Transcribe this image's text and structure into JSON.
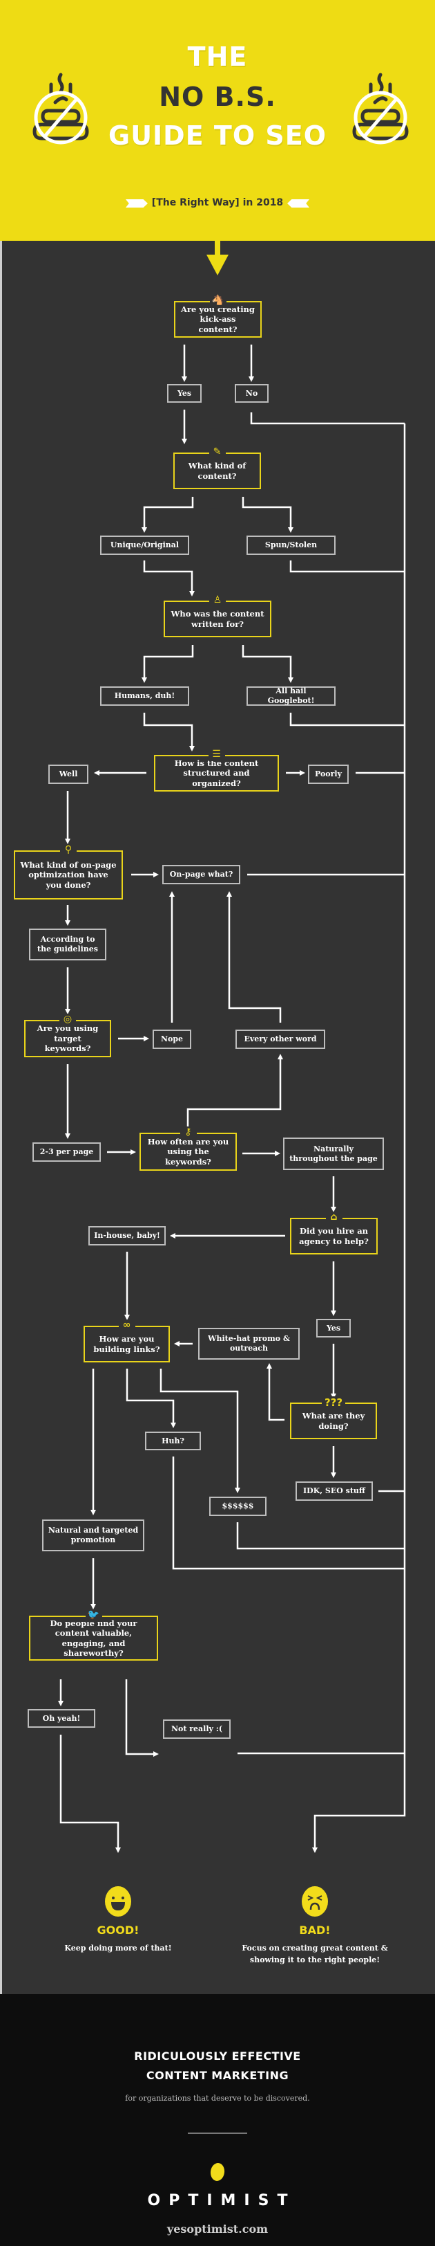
{
  "header": {
    "title_line1": "THE",
    "title_line2": "NO B.S.",
    "title_line3": "GUIDE TO SEO",
    "subtitle": "[The Right Way] in 2018",
    "icon": "no-bs-poop-icon"
  },
  "colors": {
    "brand_yellow": "#EEDC14",
    "panel_dark": "#333333",
    "footer_black": "#0d0d0d",
    "question_border": "#E9D41A",
    "answer_border": "#bdbdbd"
  },
  "flowchart": {
    "questions": [
      {
        "id": "q1",
        "text": "Are you creating kick-ass content?",
        "icon": "unicorn-icon",
        "glyph": "🐴"
      },
      {
        "id": "q2",
        "text": "What kind of content?",
        "icon": "pencil-icon",
        "glyph": "✎"
      },
      {
        "id": "q3",
        "text": "Who was the content written for?",
        "icon": "person-icon",
        "glyph": "♙"
      },
      {
        "id": "q4",
        "text": "How is the content structured and organized?",
        "icon": "layers-icon",
        "glyph": "☰"
      },
      {
        "id": "q5",
        "text": "What kind of on-page optimization have you done?",
        "icon": "magnifier-icon",
        "glyph": "⚲"
      },
      {
        "id": "q6",
        "text": "Are you using target keywords?",
        "icon": "target-icon",
        "glyph": "◎"
      },
      {
        "id": "q7",
        "text": "How often are you using the keywords?",
        "icon": "key-icon",
        "glyph": "⚷"
      },
      {
        "id": "q8",
        "text": "Did you hire an agency to help?",
        "icon": "storefront-icon",
        "glyph": "⌂"
      },
      {
        "id": "q9",
        "text": "How are you building links?",
        "icon": "link-icon",
        "glyph": "∞"
      },
      {
        "id": "q10",
        "text": "What are they doing?",
        "icon": "question-marks-icon",
        "glyph": "???"
      },
      {
        "id": "q11",
        "text": "Do people find your content valuable, engaging, and shareworthy?",
        "icon": "twitter-bird-icon",
        "glyph": "🐦"
      }
    ],
    "answers": [
      {
        "id": "yes1",
        "text": "Yes"
      },
      {
        "id": "no1",
        "text": "No"
      },
      {
        "id": "unique",
        "text": "Unique/Original"
      },
      {
        "id": "spun",
        "text": "Spun/Stolen"
      },
      {
        "id": "humans",
        "text": "Humans, duh!"
      },
      {
        "id": "googlebot",
        "text": "All hail Googlebot!"
      },
      {
        "id": "well",
        "text": "Well"
      },
      {
        "id": "poorly",
        "text": "Poorly"
      },
      {
        "id": "onpage_what",
        "text": "On-page what?"
      },
      {
        "id": "guidelines",
        "text": "According to the guidelines"
      },
      {
        "id": "nope",
        "text": "Nope"
      },
      {
        "id": "every_other",
        "text": "Every other word"
      },
      {
        "id": "two_three",
        "text": "2-3 per page"
      },
      {
        "id": "naturally",
        "text": "Naturally throughout the page"
      },
      {
        "id": "inhouse",
        "text": "In-house, baby!"
      },
      {
        "id": "yes2",
        "text": "Yes"
      },
      {
        "id": "whitehat",
        "text": "White-hat promo & outreach"
      },
      {
        "id": "huh",
        "text": "Huh?"
      },
      {
        "id": "idk",
        "text": "IDK, SEO stuff"
      },
      {
        "id": "dollars",
        "text": "$$$$$$"
      },
      {
        "id": "natural_promo",
        "text": "Natural and targeted promotion"
      },
      {
        "id": "oh_yeah",
        "text": "Oh yeah!"
      },
      {
        "id": "not_really",
        "text": "Not really :("
      }
    ]
  },
  "outcomes": {
    "good": {
      "title": "GOOD!",
      "description": "Keep doing more of that!",
      "icon": "happy-face-icon"
    },
    "bad": {
      "title": "BAD!",
      "description": "Focus on creating great content & showing it to the right people!",
      "icon": "angry-face-icon"
    }
  },
  "footer": {
    "headline_line1": "RIDICULOUSLY EFFECTIVE",
    "headline_line2": "CONTENT MARKETING",
    "tagline": "for organizations that deserve to be discovered.",
    "brand": "OPTIMIST",
    "website": "yesoptimist.com"
  }
}
